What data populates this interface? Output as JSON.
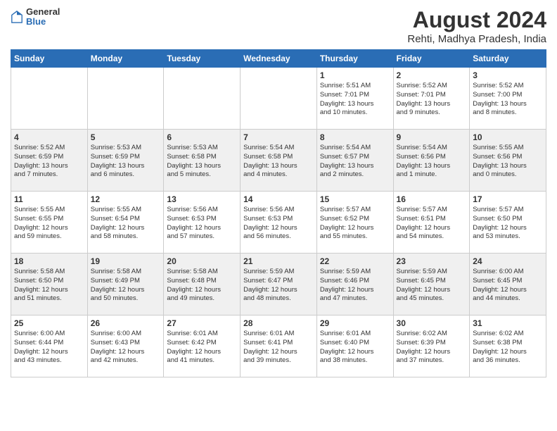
{
  "logo": {
    "line1": "General",
    "line2": "Blue"
  },
  "title": "August 2024",
  "location": "Rehti, Madhya Pradesh, India",
  "days_of_week": [
    "Sunday",
    "Monday",
    "Tuesday",
    "Wednesday",
    "Thursday",
    "Friday",
    "Saturday"
  ],
  "weeks": [
    [
      {
        "day": "",
        "content": ""
      },
      {
        "day": "",
        "content": ""
      },
      {
        "day": "",
        "content": ""
      },
      {
        "day": "",
        "content": ""
      },
      {
        "day": "1",
        "content": "Sunrise: 5:51 AM\nSunset: 7:01 PM\nDaylight: 13 hours\nand 10 minutes."
      },
      {
        "day": "2",
        "content": "Sunrise: 5:52 AM\nSunset: 7:01 PM\nDaylight: 13 hours\nand 9 minutes."
      },
      {
        "day": "3",
        "content": "Sunrise: 5:52 AM\nSunset: 7:00 PM\nDaylight: 13 hours\nand 8 minutes."
      }
    ],
    [
      {
        "day": "4",
        "content": "Sunrise: 5:52 AM\nSunset: 6:59 PM\nDaylight: 13 hours\nand 7 minutes."
      },
      {
        "day": "5",
        "content": "Sunrise: 5:53 AM\nSunset: 6:59 PM\nDaylight: 13 hours\nand 6 minutes."
      },
      {
        "day": "6",
        "content": "Sunrise: 5:53 AM\nSunset: 6:58 PM\nDaylight: 13 hours\nand 5 minutes."
      },
      {
        "day": "7",
        "content": "Sunrise: 5:54 AM\nSunset: 6:58 PM\nDaylight: 13 hours\nand 4 minutes."
      },
      {
        "day": "8",
        "content": "Sunrise: 5:54 AM\nSunset: 6:57 PM\nDaylight: 13 hours\nand 2 minutes."
      },
      {
        "day": "9",
        "content": "Sunrise: 5:54 AM\nSunset: 6:56 PM\nDaylight: 13 hours\nand 1 minute."
      },
      {
        "day": "10",
        "content": "Sunrise: 5:55 AM\nSunset: 6:56 PM\nDaylight: 13 hours\nand 0 minutes."
      }
    ],
    [
      {
        "day": "11",
        "content": "Sunrise: 5:55 AM\nSunset: 6:55 PM\nDaylight: 12 hours\nand 59 minutes."
      },
      {
        "day": "12",
        "content": "Sunrise: 5:55 AM\nSunset: 6:54 PM\nDaylight: 12 hours\nand 58 minutes."
      },
      {
        "day": "13",
        "content": "Sunrise: 5:56 AM\nSunset: 6:53 PM\nDaylight: 12 hours\nand 57 minutes."
      },
      {
        "day": "14",
        "content": "Sunrise: 5:56 AM\nSunset: 6:53 PM\nDaylight: 12 hours\nand 56 minutes."
      },
      {
        "day": "15",
        "content": "Sunrise: 5:57 AM\nSunset: 6:52 PM\nDaylight: 12 hours\nand 55 minutes."
      },
      {
        "day": "16",
        "content": "Sunrise: 5:57 AM\nSunset: 6:51 PM\nDaylight: 12 hours\nand 54 minutes."
      },
      {
        "day": "17",
        "content": "Sunrise: 5:57 AM\nSunset: 6:50 PM\nDaylight: 12 hours\nand 53 minutes."
      }
    ],
    [
      {
        "day": "18",
        "content": "Sunrise: 5:58 AM\nSunset: 6:50 PM\nDaylight: 12 hours\nand 51 minutes."
      },
      {
        "day": "19",
        "content": "Sunrise: 5:58 AM\nSunset: 6:49 PM\nDaylight: 12 hours\nand 50 minutes."
      },
      {
        "day": "20",
        "content": "Sunrise: 5:58 AM\nSunset: 6:48 PM\nDaylight: 12 hours\nand 49 minutes."
      },
      {
        "day": "21",
        "content": "Sunrise: 5:59 AM\nSunset: 6:47 PM\nDaylight: 12 hours\nand 48 minutes."
      },
      {
        "day": "22",
        "content": "Sunrise: 5:59 AM\nSunset: 6:46 PM\nDaylight: 12 hours\nand 47 minutes."
      },
      {
        "day": "23",
        "content": "Sunrise: 5:59 AM\nSunset: 6:45 PM\nDaylight: 12 hours\nand 45 minutes."
      },
      {
        "day": "24",
        "content": "Sunrise: 6:00 AM\nSunset: 6:45 PM\nDaylight: 12 hours\nand 44 minutes."
      }
    ],
    [
      {
        "day": "25",
        "content": "Sunrise: 6:00 AM\nSunset: 6:44 PM\nDaylight: 12 hours\nand 43 minutes."
      },
      {
        "day": "26",
        "content": "Sunrise: 6:00 AM\nSunset: 6:43 PM\nDaylight: 12 hours\nand 42 minutes."
      },
      {
        "day": "27",
        "content": "Sunrise: 6:01 AM\nSunset: 6:42 PM\nDaylight: 12 hours\nand 41 minutes."
      },
      {
        "day": "28",
        "content": "Sunrise: 6:01 AM\nSunset: 6:41 PM\nDaylight: 12 hours\nand 39 minutes."
      },
      {
        "day": "29",
        "content": "Sunrise: 6:01 AM\nSunset: 6:40 PM\nDaylight: 12 hours\nand 38 minutes."
      },
      {
        "day": "30",
        "content": "Sunrise: 6:02 AM\nSunset: 6:39 PM\nDaylight: 12 hours\nand 37 minutes."
      },
      {
        "day": "31",
        "content": "Sunrise: 6:02 AM\nSunset: 6:38 PM\nDaylight: 12 hours\nand 36 minutes."
      }
    ]
  ]
}
